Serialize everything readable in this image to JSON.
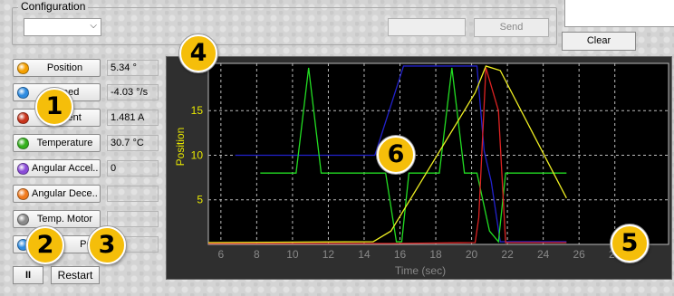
{
  "config": {
    "group_label": "Configuration",
    "select_value": "",
    "send_input_value": "",
    "send_label": "Send",
    "clear_label": "Clear"
  },
  "channels": [
    {
      "label": "Position",
      "value": "5.34 °",
      "color": "#f5a000"
    },
    {
      "label": "Speed",
      "value": "-4.03 °/s",
      "color": "#2e8be0"
    },
    {
      "label": "Current",
      "value": "1.481 A",
      "color": "#c8341c"
    },
    {
      "label": "Temperature",
      "value": "30.7 °C",
      "color": "#34b01c"
    },
    {
      "label": "Angular Accel...",
      "value": "0",
      "color": "#8a4cd8"
    },
    {
      "label": "Angular Dece...",
      "value": "",
      "color": "#f07a1e"
    },
    {
      "label": "Temp. Motor",
      "value": "",
      "color": "#8a8a8a"
    },
    {
      "label": "PO",
      "value": "",
      "color": "#2e8be0"
    }
  ],
  "controls": {
    "pause_label": "II",
    "restart_label": "Restart"
  },
  "callouts": [
    "1",
    "2",
    "3",
    "4",
    "5",
    "6"
  ],
  "chart_data": {
    "type": "line",
    "xlabel": "Time (sec)",
    "ylabel": "Position",
    "xlim": [
      5.3,
      31
    ],
    "ylim": [
      0,
      20.3
    ],
    "xticks": [
      6,
      8,
      10,
      12,
      14,
      16,
      18,
      20,
      22,
      24,
      26,
      28
    ],
    "yticks": [
      5,
      10,
      15
    ],
    "grid": true,
    "series": [
      {
        "color": "#2222cc",
        "x": [
          6.8,
          14.6,
          15.8,
          16.2,
          20.3,
          20.7,
          21.1,
          21.6,
          25.3
        ],
        "y": [
          10,
          10,
          17.5,
          20,
          20,
          10.5,
          7,
          0.3,
          0.3
        ]
      },
      {
        "color": "#22dd22",
        "x": [
          8.2,
          10.2,
          10.9,
          11.6,
          15.2,
          15.8,
          16.1,
          16.5,
          18.2,
          18.9,
          19.6,
          20.3,
          21.0,
          21.5,
          21.9,
          25.3
        ],
        "y": [
          8,
          8,
          19.8,
          8,
          8,
          0.3,
          0.3,
          8,
          8,
          19.8,
          8,
          8,
          1.5,
          0.3,
          8,
          8
        ]
      },
      {
        "color": "#dd2222",
        "x": [
          5.3,
          15.5,
          20.2,
          20.4,
          20.8,
          21.5,
          21.9,
          25.3
        ],
        "y": [
          0.1,
          0.1,
          0.2,
          3,
          19.8,
          15,
          0.2,
          0.2
        ]
      },
      {
        "color": "#eeee22",
        "x": [
          5.3,
          14.5,
          15.5,
          20.2,
          20.8,
          21.6,
          25.3
        ],
        "y": [
          0.2,
          0.3,
          1.5,
          17,
          20,
          19.5,
          5.2
        ]
      }
    ]
  }
}
